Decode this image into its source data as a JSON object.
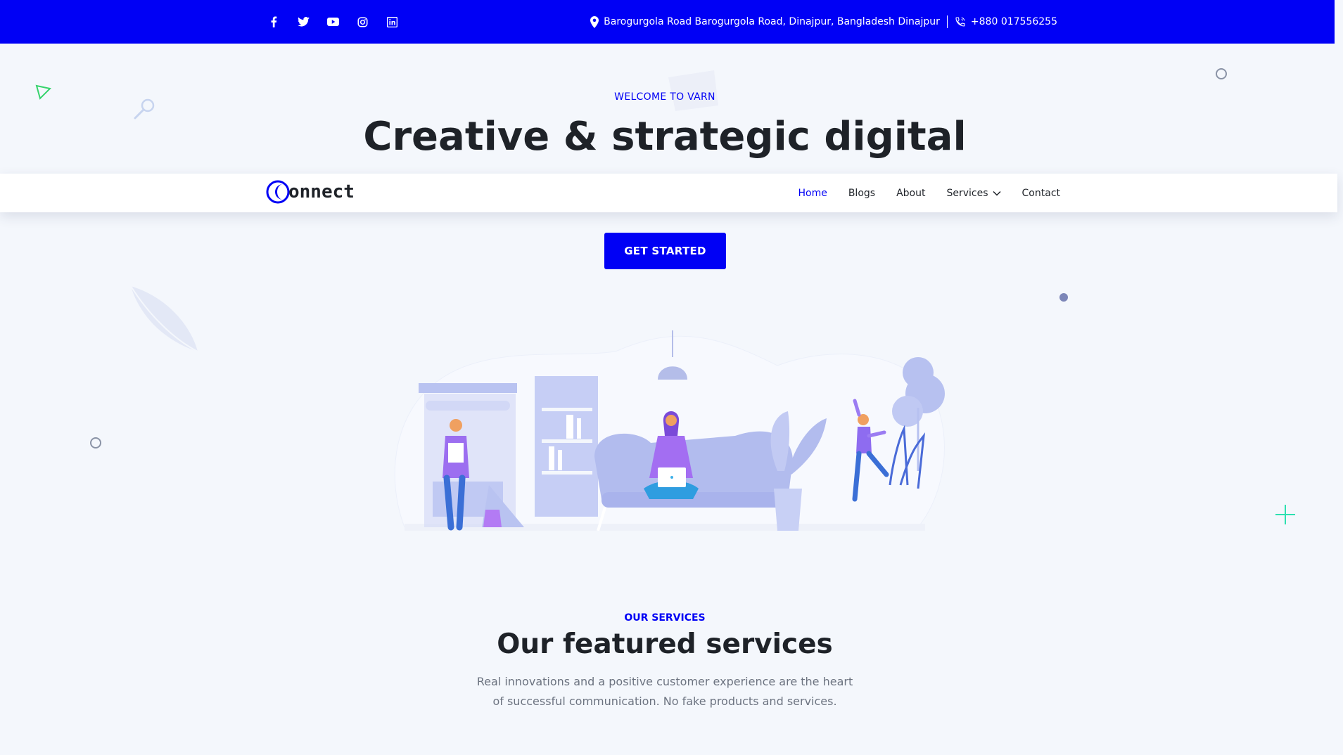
{
  "topbar": {
    "social_icons": [
      "facebook-icon",
      "twitter-icon",
      "youtube-icon",
      "instagram-icon",
      "linkedin-icon"
    ],
    "address": "Barogurgola Road Barogurgola Road, Dinajpur, Bangladesh Dinajpur",
    "phone": "+880 017556255"
  },
  "hero": {
    "welcome": "WELCOME TO VARN",
    "title": "Creative & strategic digital",
    "cta": "GET STARTED"
  },
  "navbar": {
    "logo_text": "onnect",
    "items": [
      {
        "label": "Home",
        "active": true
      },
      {
        "label": "Blogs"
      },
      {
        "label": "About"
      },
      {
        "label": "Services",
        "dropdown": true
      },
      {
        "label": "Contact"
      }
    ]
  },
  "services": {
    "label": "OUR SERVICES",
    "title": "Our featured services",
    "description": "Real innovations and a positive customer experience are the heart of successful communication. No fake products and services."
  },
  "colors": {
    "primary": "#0000f5",
    "background": "#f4f7fc",
    "heading": "#1e2228",
    "muted": "#6c7380"
  }
}
